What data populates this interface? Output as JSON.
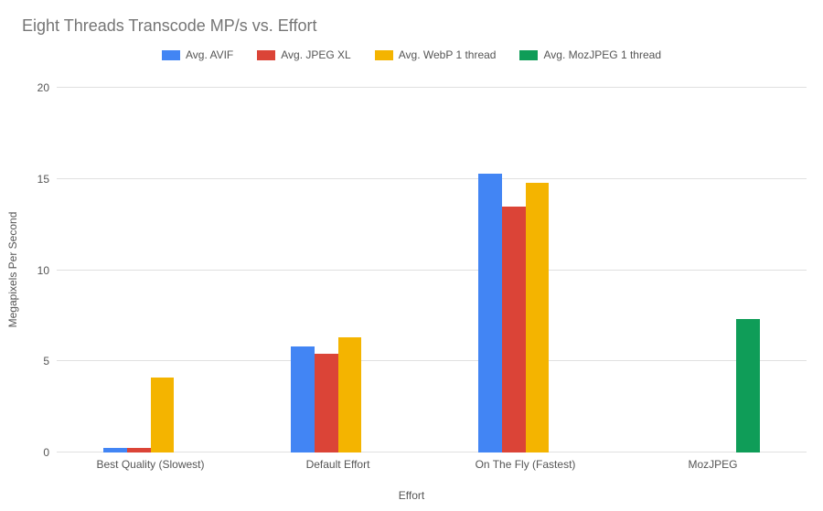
{
  "chart_data": {
    "type": "bar",
    "title": "Eight Threads Transcode MP/s vs. Effort",
    "xlabel": "Effort",
    "ylabel": "Megapixels Per Second",
    "ylim": [
      0,
      20
    ],
    "yticks": [
      0,
      5,
      10,
      15,
      20
    ],
    "categories": [
      "Best Quality (Slowest)",
      "Default Effort",
      "On The Fly (Fastest)",
      "MozJPEG"
    ],
    "series": [
      {
        "name": "Avg. AVIF",
        "color": "#4285F4",
        "values": [
          0.25,
          5.8,
          15.3,
          null
        ]
      },
      {
        "name": "Avg. JPEG XL",
        "color": "#DB4437",
        "values": [
          0.25,
          5.4,
          13.5,
          null
        ]
      },
      {
        "name": "Avg. WebP 1 thread",
        "color": "#F4B400",
        "values": [
          4.1,
          6.3,
          14.8,
          null
        ]
      },
      {
        "name": "Avg. MozJPEG 1 thread",
        "color": "#0F9D58",
        "values": [
          null,
          null,
          null,
          7.3
        ]
      }
    ],
    "legend_position": "top",
    "grid": true
  }
}
